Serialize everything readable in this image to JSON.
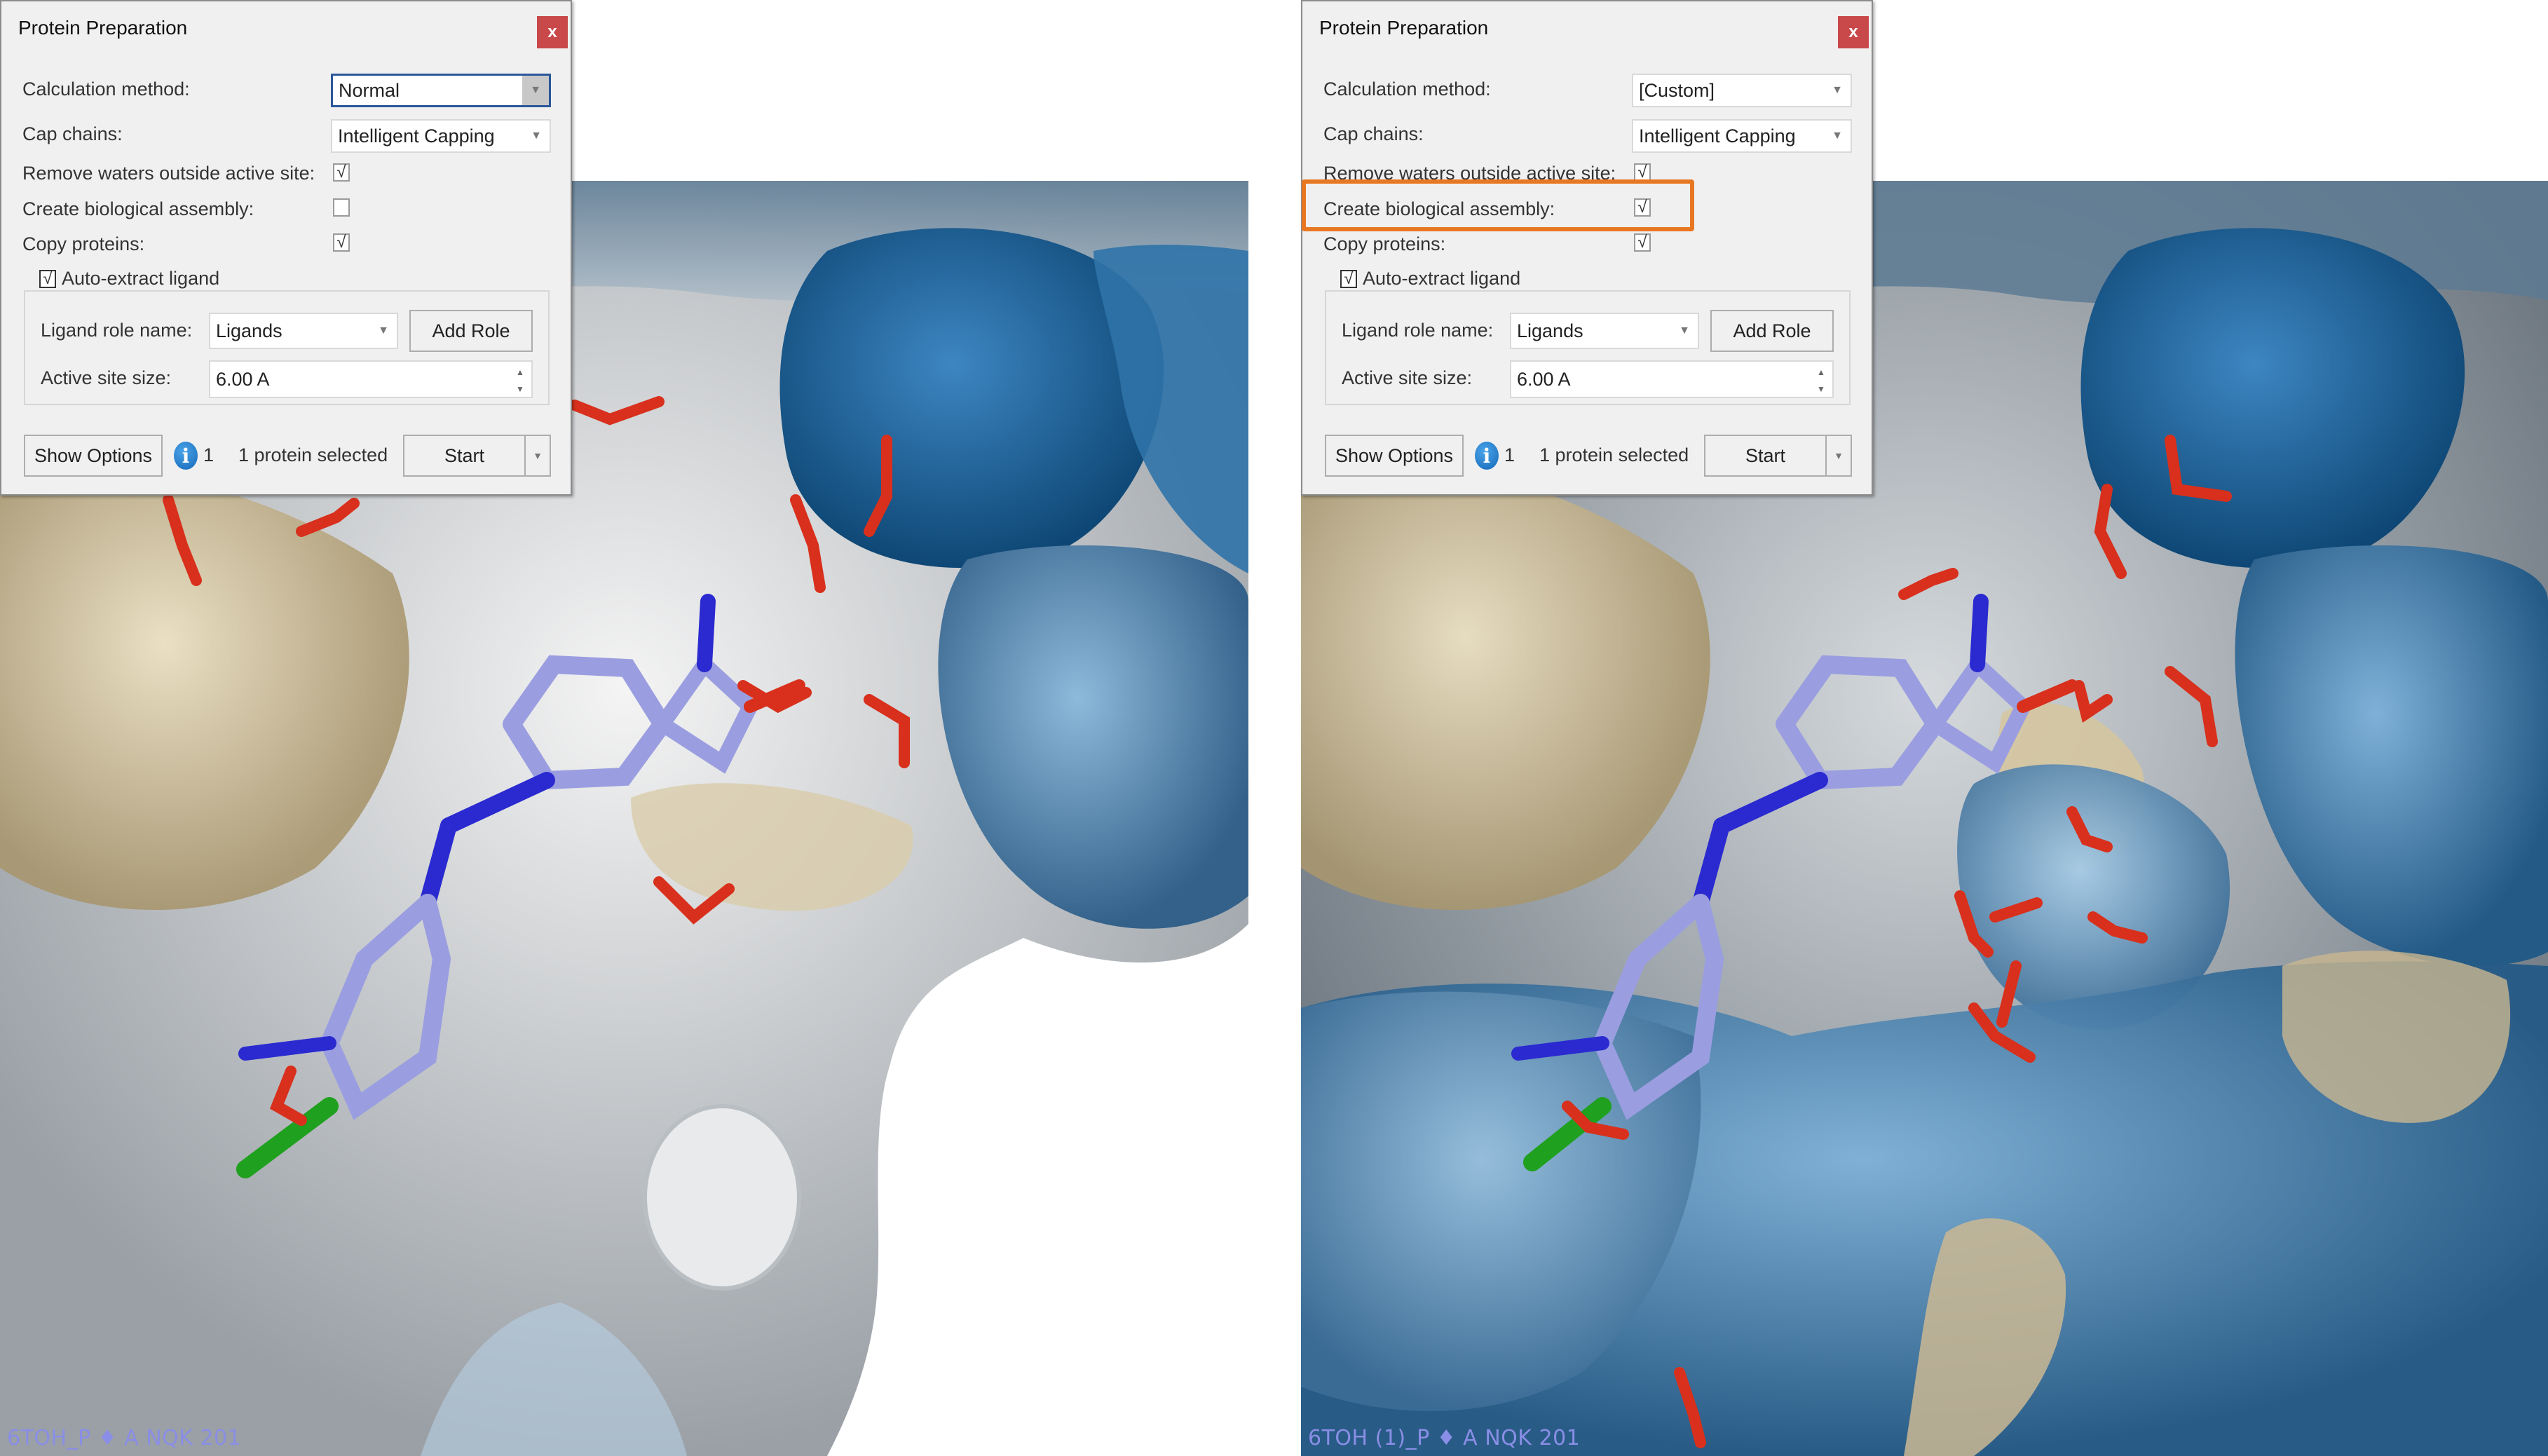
{
  "panels": [
    {
      "id": "left",
      "dialog": {
        "title": "Protein Preparation",
        "close_label": "x",
        "calculation_method": {
          "label": "Calculation method:",
          "value": "Normal"
        },
        "cap_chains": {
          "label": "Cap chains:",
          "value": "Intelligent Capping"
        },
        "remove_waters": {
          "label": "Remove waters outside active site:",
          "checked": true
        },
        "create_bio_assembly": {
          "label": "Create biological assembly:",
          "checked": false
        },
        "copy_proteins": {
          "label": "Copy proteins:",
          "checked": true
        },
        "auto_extract": {
          "label": "Auto-extract ligand",
          "checked": true
        },
        "ligand_role": {
          "label": "Ligand role name:",
          "value": "Ligands",
          "add_role_label": "Add Role"
        },
        "active_site": {
          "label": "Active site size:",
          "value": "6.00 A"
        },
        "footer": {
          "show_options_label": "Show Options",
          "info_count": "1",
          "status": "1 protein selected",
          "start_label": "Start"
        }
      },
      "viewport_label": "6TOH_P ♦ A NQK 201"
    },
    {
      "id": "right",
      "dialog": {
        "title": "Protein Preparation",
        "close_label": "x",
        "calculation_method": {
          "label": "Calculation method:",
          "value": "[Custom]"
        },
        "cap_chains": {
          "label": "Cap chains:",
          "value": "Intelligent Capping"
        },
        "remove_waters": {
          "label": "Remove waters outside active site:",
          "checked": true
        },
        "create_bio_assembly": {
          "label": "Create biological assembly:",
          "checked": true,
          "highlighted": true
        },
        "copy_proteins": {
          "label": "Copy proteins:",
          "checked": true
        },
        "auto_extract": {
          "label": "Auto-extract ligand",
          "checked": true
        },
        "ligand_role": {
          "label": "Ligand role name:",
          "value": "Ligands",
          "add_role_label": "Add Role"
        },
        "active_site": {
          "label": "Active site size:",
          "value": "6.00 A"
        },
        "footer": {
          "show_options_label": "Show Options",
          "info_count": "1",
          "status": "1 protein selected",
          "start_label": "Start"
        }
      },
      "viewport_label": "6TOH (1)_P ♦ A NQK 201"
    }
  ],
  "icons": {
    "check": "√",
    "dropdown_arrow": "▼",
    "spin_up": "▲",
    "spin_down": "▼",
    "info": "i"
  },
  "colors": {
    "highlight": "#e87722",
    "close_button": "#c9484a",
    "ligand_carbon": "#9a9ee0",
    "nitrogen": "#2a2ad0",
    "oxygen": "#d8301c",
    "chlorine": "#1fa01f",
    "surface_blue_dark": "#1a5f96",
    "surface_blue_light": "#6fa3c9",
    "surface_tan": "#c9b690",
    "surface_grey": "#c8ccd0"
  }
}
